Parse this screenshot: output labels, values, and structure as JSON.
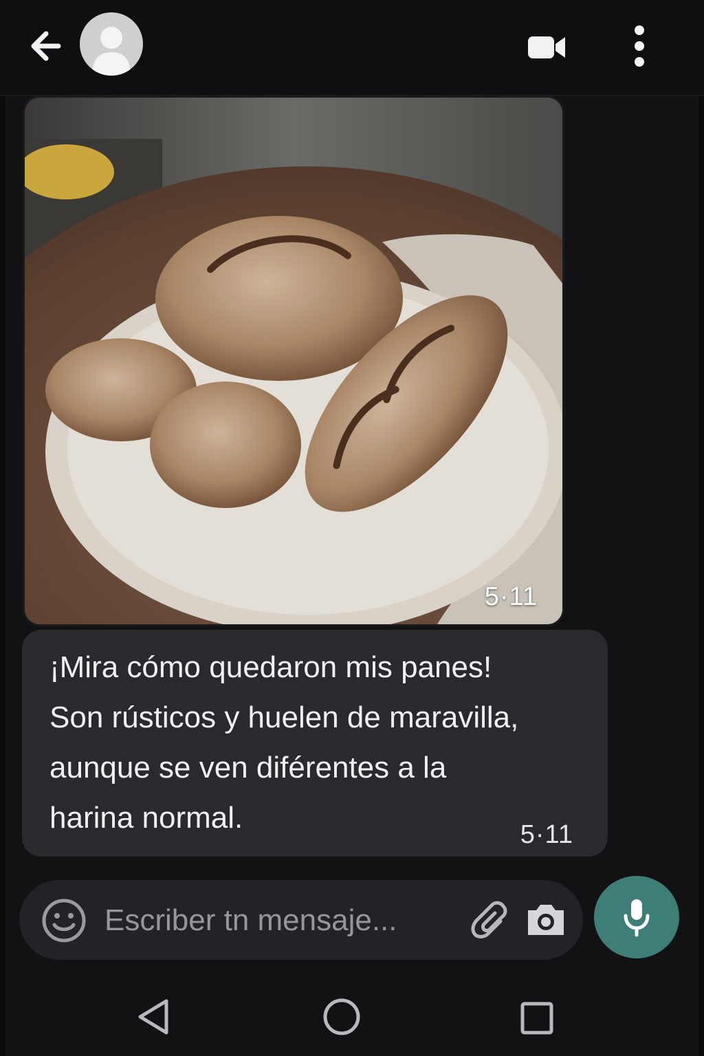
{
  "header": {
    "back_icon": "arrow-left-icon",
    "avatar_icon": "person-icon",
    "video_icon": "video-camera-icon",
    "menu_icon": "more-vertical-icon"
  },
  "messages": [
    {
      "type": "image",
      "image_description": "Rustic breads on a speckled plate",
      "time": "5·11"
    },
    {
      "type": "text",
      "text": "¡Mira cómo quedaron mis panes!\nSon rústicos y huelen de maravilla,\naunque se ven diférentes a la\nharina normal.",
      "time": "5·11"
    }
  ],
  "composer": {
    "placeholder": "Escriber tn mensaje...",
    "emoji_icon": "emoji-icon",
    "attach_icon": "paperclip-icon",
    "camera_icon": "camera-icon",
    "mic_icon": "microphone-icon"
  },
  "colors": {
    "background": "#121114",
    "bubble": "#2a292d",
    "composer": "#232226",
    "mic_button": "#3d7f77"
  },
  "navbar": {
    "back_icon": "nav-back-icon",
    "home_icon": "nav-home-icon",
    "recents_icon": "nav-recents-icon"
  }
}
